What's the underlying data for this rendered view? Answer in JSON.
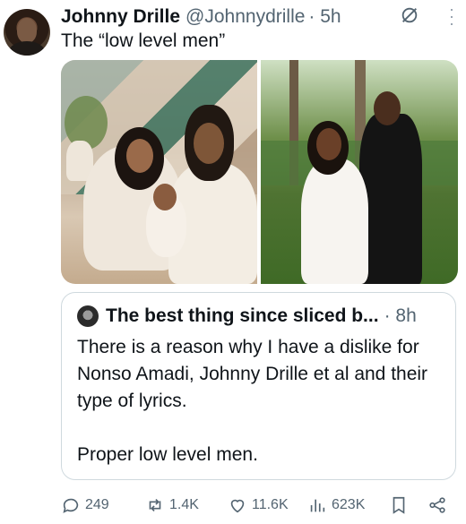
{
  "author": {
    "name": "Johnny Drille",
    "handle": "@Johnnydrille",
    "time": "· 5h"
  },
  "tweet": {
    "text": "The “low level men”"
  },
  "quoted": {
    "name": "The best thing since sliced b...",
    "time": "· 8h",
    "lines": [
      "There is a reason why I have a dislike for Nonso Amadi, Johnny Drille et al and their type of lyrics.",
      "",
      "Proper low level men."
    ]
  },
  "actions": {
    "replies": "249",
    "reposts": "1.4K",
    "likes": "11.6K",
    "views": "623K"
  },
  "colors": {
    "text": "#0f1419",
    "secondary": "#536471",
    "border": "#cfd9de"
  }
}
